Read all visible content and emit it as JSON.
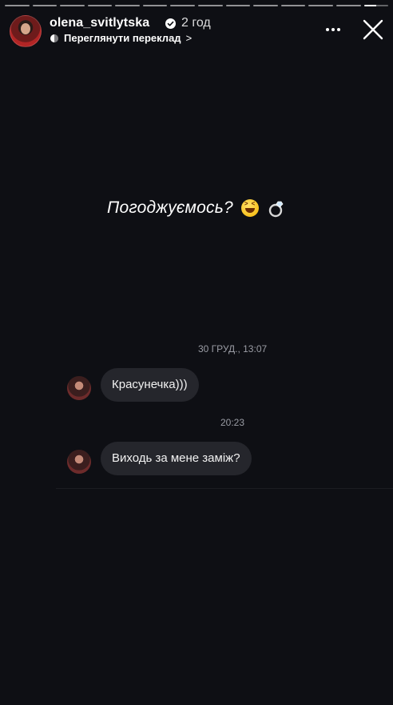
{
  "story": {
    "progress_segments": 14,
    "active_segment_index": 13,
    "active_segment_progress": 0.5
  },
  "header": {
    "username": "olena_svitlytska",
    "verified": true,
    "time": "2 год",
    "translate_label": "Переглянути переклад",
    "translate_chevron": ">"
  },
  "caption": {
    "text": "Погоджуємось?",
    "emojis": [
      "laughing-face-icon",
      "ring-icon"
    ]
  },
  "chat": {
    "timestamp_1": "30 ГРУД., 13:07",
    "message_1": "Красунечка)))",
    "timestamp_2": "20:23",
    "message_2": "Виходь за мене заміж?"
  },
  "colors": {
    "background": "#0e0f14",
    "bubble": "#25262c",
    "timestamp": "#9a9ca4",
    "text": "#ffffff"
  }
}
